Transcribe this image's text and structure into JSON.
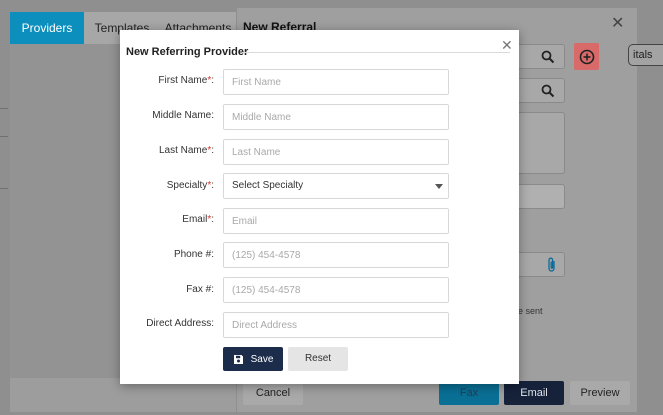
{
  "left_tabs": [
    {
      "label": "Providers",
      "active": true
    },
    {
      "label": "Templates",
      "active": false
    },
    {
      "label": "Attachments",
      "active": false
    }
  ],
  "referral": {
    "title": "New Referral",
    "chip_label": "itals",
    "sent_text": "e sent",
    "buttons": {
      "cancel": "Cancel",
      "fax": "Fax",
      "email": "Email",
      "preview": "Preview"
    }
  },
  "modal": {
    "title": "New Referring Provider",
    "fields": {
      "first_name": {
        "label": "First Name",
        "required": true,
        "placeholder": "First Name"
      },
      "middle_name": {
        "label": "Middle Name:",
        "required": false,
        "placeholder": "Middle Name"
      },
      "last_name": {
        "label": "Last Name",
        "required": true,
        "placeholder": "Last Name"
      },
      "specialty": {
        "label": "Specialty",
        "required": true,
        "value": "Select Specialty"
      },
      "email": {
        "label": "Email",
        "required": true,
        "placeholder": "Email"
      },
      "phone": {
        "label": "Phone #:",
        "required": false,
        "placeholder": "(125) 454-4578"
      },
      "fax": {
        "label": "Fax #:",
        "required": false,
        "placeholder": "(125) 454-4578"
      },
      "direct_address": {
        "label": "Direct Address:",
        "required": false,
        "placeholder": "Direct Address"
      }
    },
    "required_suffix": "*",
    "colon": ":",
    "save_label": "Save",
    "reset_label": "Reset"
  },
  "colors": {
    "active_tab": "#0c8fbd",
    "save_button": "#1c2d4c",
    "required": "#d9302a",
    "plus_button": "#d96a6a"
  },
  "icons": [
    "search-icon",
    "plus-circle-icon",
    "paperclip-icon",
    "close-icon",
    "save-icon",
    "chevron-down-icon"
  ]
}
